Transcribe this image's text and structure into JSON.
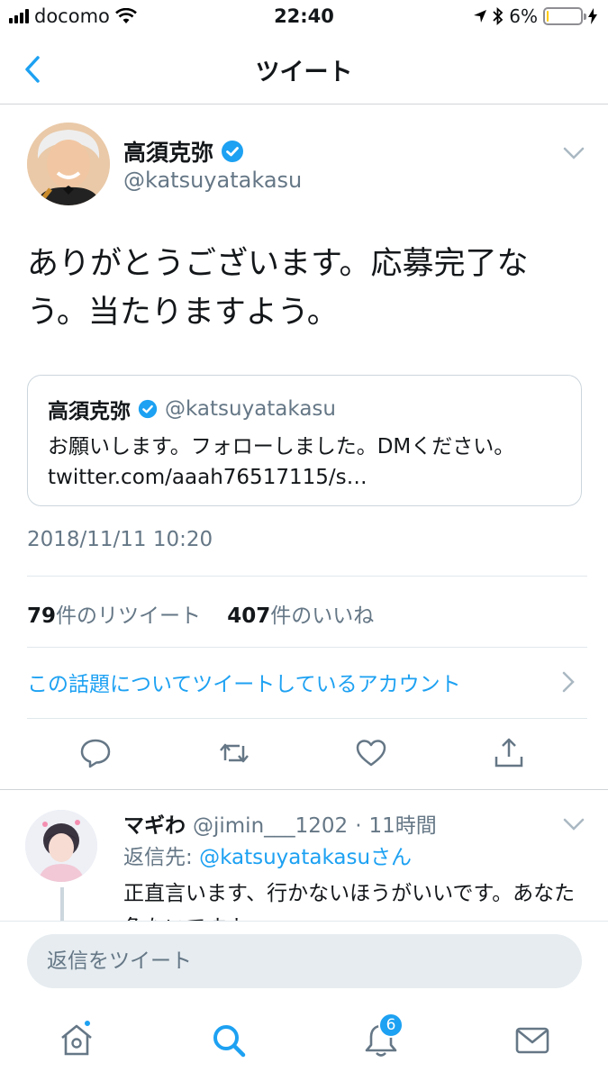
{
  "status_bar": {
    "carrier": "docomo",
    "time": "22:40",
    "battery": "6%",
    "battery_level": 0.06
  },
  "nav": {
    "title": "ツイート",
    "back_icon": "chevron-left-icon"
  },
  "tweet": {
    "author_name": "高須克弥",
    "author_handle": "@katsuyatakasu",
    "verified": true,
    "text": "ありがとうございます。応募完了なう。当たりますよう。",
    "quote": {
      "author_name": "高須克弥",
      "author_handle": "@katsuyatakasu",
      "text": "お願いします。フォローしました。DMください。 twitter.com/aaah76517115/s…"
    },
    "timestamp": "2018/11/11 10:20",
    "retweet_count": "79",
    "retweet_label": "件のリツイート",
    "like_count": "407",
    "like_label": "件のいいね",
    "topic_link": "この話題についてツイートしているアカウント"
  },
  "reply": {
    "author_name": "マギわ",
    "author_handle": "@jimin___1202",
    "time": "11時間",
    "reply_to_label": "返信先:",
    "reply_to_mention": "@katsuyatakasu",
    "reply_to_suffix": "さん",
    "text": "正直言います、行かないほうがいいです。あなた危ないですよ"
  },
  "composer": {
    "placeholder": "返信をツイート"
  },
  "tab_bar": {
    "notifications_badge": "6"
  },
  "colors": {
    "accent": "#1da1f2",
    "secondary_text": "#657786",
    "battery_low": "#ffcc00"
  }
}
